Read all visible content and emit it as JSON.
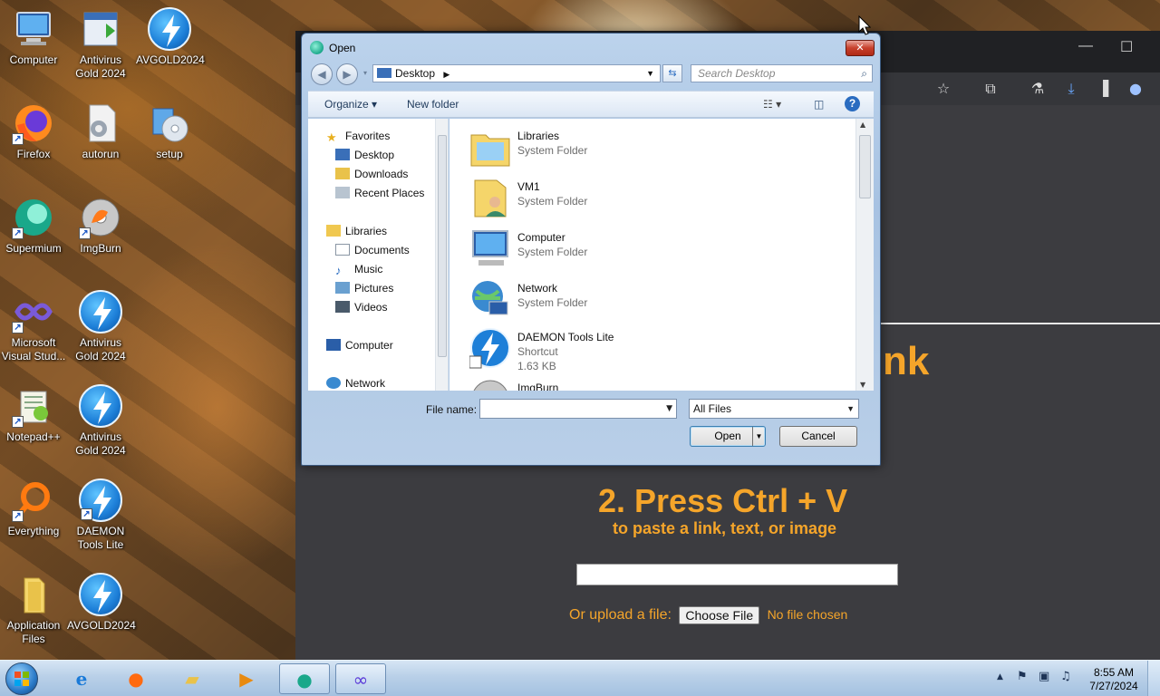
{
  "desktop": {
    "icons": [
      {
        "label": "Computer",
        "icon": "computer-icon"
      },
      {
        "label": "Antivirus Gold 2024",
        "icon": "installer-icon"
      },
      {
        "label": "AVGOLD2024",
        "icon": "antivirus-bolt-icon"
      },
      {
        "label": "Firefox",
        "icon": "firefox-icon"
      },
      {
        "label": "autorun",
        "icon": "settings-file-icon"
      },
      {
        "label": "setup",
        "icon": "setup-icon"
      },
      {
        "label": "Supermium",
        "icon": "supermium-icon"
      },
      {
        "label": "ImgBurn",
        "icon": "imgburn-icon"
      },
      {
        "label": "Microsoft Visual Stud...",
        "icon": "visual-studio-icon"
      },
      {
        "label": "Antivirus Gold 2024",
        "icon": "antivirus-bolt-icon"
      },
      {
        "label": "Notepad++",
        "icon": "notepadpp-icon"
      },
      {
        "label": "Antivirus Gold 2024",
        "icon": "antivirus-bolt-icon"
      },
      {
        "label": "Everything",
        "icon": "everything-icon"
      },
      {
        "label": "DAEMON Tools Lite",
        "icon": "antivirus-bolt-icon"
      },
      {
        "label": "Application Files",
        "icon": "folder-icon"
      },
      {
        "label": "AVGOLD2024",
        "icon": "antivirus-bolt-icon"
      }
    ]
  },
  "browser": {
    "heading_fragment": "nk",
    "step2_title": "2. Press Ctrl + V",
    "step2_subtitle": "to paste a link, text, or image",
    "upload_label": "Or upload a file:",
    "choose_file_button": "Choose File",
    "no_file_text": "No file chosen",
    "accent_color": "#f5a52a"
  },
  "dialog": {
    "title": "Open",
    "address": "Desktop",
    "search_placeholder": "Search Desktop",
    "organize_label": "Organize",
    "new_folder_label": "New folder",
    "nav": {
      "favorites": "Favorites",
      "favorites_items": [
        "Desktop",
        "Downloads",
        "Recent Places"
      ],
      "libraries": "Libraries",
      "libraries_items": [
        "Documents",
        "Music",
        "Pictures",
        "Videos"
      ],
      "computer": "Computer",
      "network": "Network"
    },
    "files": [
      {
        "name": "Libraries",
        "type": "System Folder",
        "size": "",
        "icon": "libraries-folder-icon"
      },
      {
        "name": "VM1",
        "type": "System Folder",
        "size": "",
        "icon": "user-folder-icon"
      },
      {
        "name": "Computer",
        "type": "System Folder",
        "size": "",
        "icon": "computer-icon"
      },
      {
        "name": "Network",
        "type": "System Folder",
        "size": "",
        "icon": "network-icon"
      },
      {
        "name": "DAEMON Tools Lite",
        "type": "Shortcut",
        "size": "1.63 KB",
        "icon": "antivirus-bolt-icon"
      },
      {
        "name": "ImgBurn",
        "type": "",
        "size": "",
        "icon": "imgburn-icon"
      }
    ],
    "file_name_label": "File name:",
    "file_name_value": "",
    "file_type_selected": "All Files",
    "open_button": "Open",
    "cancel_button": "Cancel"
  },
  "taskbar": {
    "time": "8:55 AM",
    "date": "7/27/2024"
  }
}
